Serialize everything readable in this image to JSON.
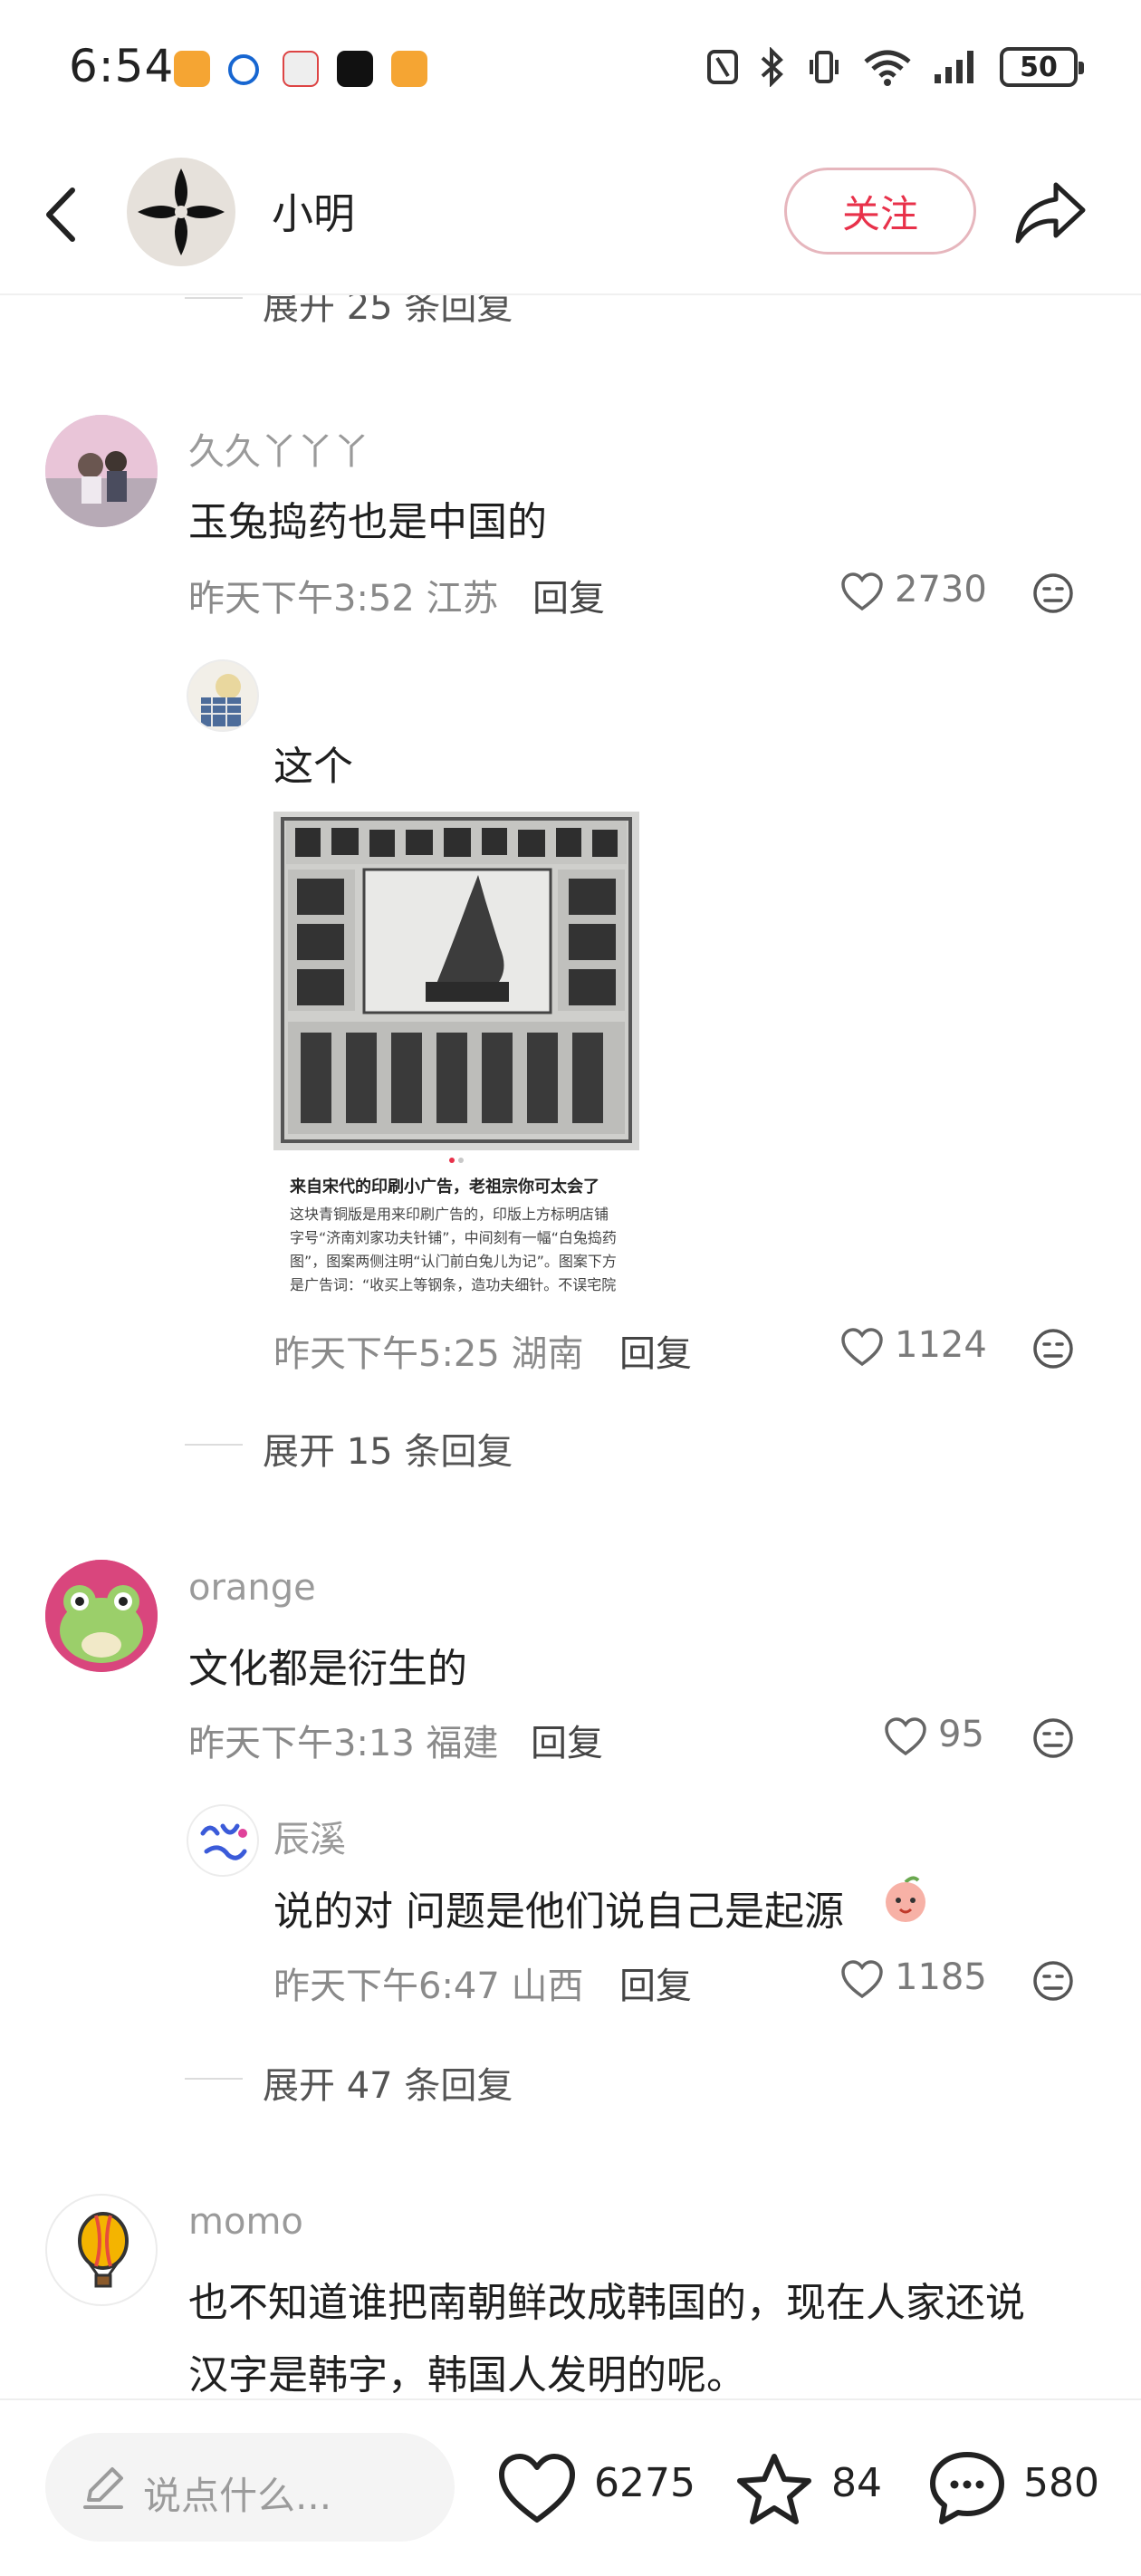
{
  "status_bar": {
    "time": "6:54",
    "battery": "50"
  },
  "header": {
    "username": "小明",
    "follow_label": "关注"
  },
  "top_expand": "展开 25 条回复",
  "comments": [
    {
      "username": "久久丫丫丫",
      "text": "玉兔捣药也是中国的",
      "meta": "昨天下午3:52 江苏",
      "reply_label": "回复",
      "likes": "2730",
      "replies": [
        {
          "text": "这个",
          "image_caption_title": "来自宋代的印刷小广告，老祖宗你可太会了",
          "image_caption_body": "这块青铜版是用来印刷广告的，印版上方标明店铺\n字号“济南刘家功夫针铺”，中间刻有一幅“白兔捣药\n图”，图案两侧注明“认门前白兔儿为记”。图案下方\n是广告词：“收买上等钢条，造功夫细针。不误宅院",
          "meta": "昨天下午5:25 湖南",
          "reply_label": "回复",
          "likes": "1124"
        }
      ],
      "expand": "展开 15 条回复"
    },
    {
      "username": "orange",
      "text": "文化都是衍生的",
      "meta": "昨天下午3:13 福建",
      "reply_label": "回复",
      "likes": "95",
      "replies": [
        {
          "username": "辰溪",
          "text": "说的对 问题是他们说自己是起源",
          "meta": "昨天下午6:47 山西",
          "reply_label": "回复",
          "likes": "1185"
        }
      ],
      "expand": "展开 47 条回复"
    },
    {
      "username": "momo",
      "text_line1": "也不知道谁把南朝鲜改成韩国的，现在人家还说",
      "text_line2": "汉字是韩字，韩国人发明的呢。"
    }
  ],
  "bottom_bar": {
    "input_placeholder": "说点什么...",
    "likes": "6275",
    "favorites": "84",
    "comments": "580"
  },
  "colors": {
    "accent": "#e8314a",
    "follow_border": "#e6b6bd"
  },
  "icons": [
    "back-arrow-icon",
    "share-icon",
    "heart-icon",
    "dislike-face-icon",
    "pencil-icon",
    "star-icon",
    "chat-bubble-icon"
  ]
}
